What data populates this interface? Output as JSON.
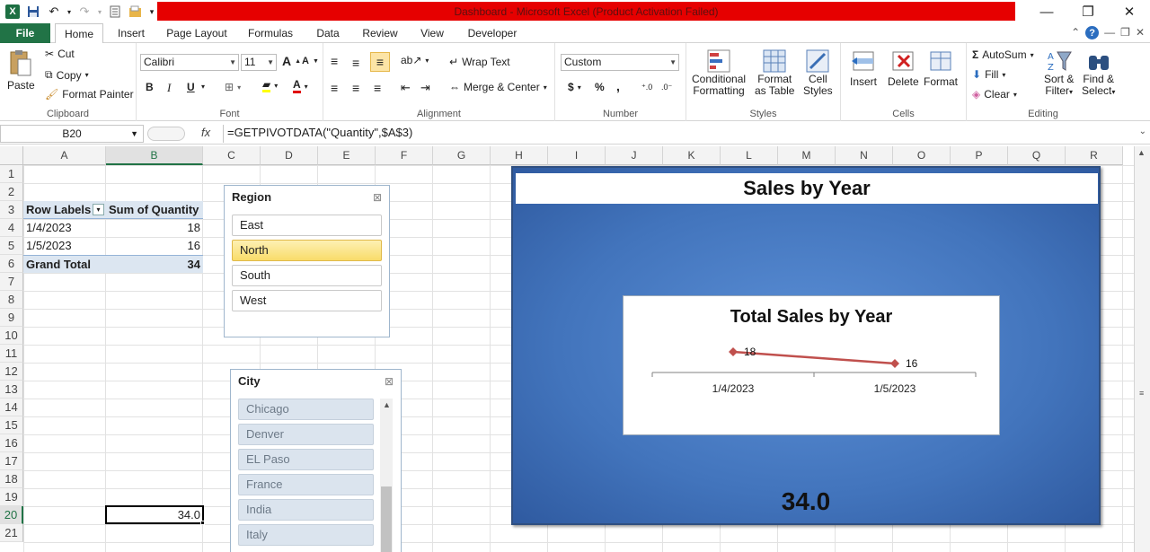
{
  "window": {
    "title": "Dashboard - Microsoft Excel (Product Activation Failed)"
  },
  "tabs": [
    "File",
    "Home",
    "Insert",
    "Page Layout",
    "Formulas",
    "Data",
    "Review",
    "View",
    "Developer"
  ],
  "ribbon": {
    "clipboard": {
      "paste": "Paste",
      "cut": "Cut",
      "copy": "Copy",
      "format_painter": "Format Painter",
      "label": "Clipboard"
    },
    "font": {
      "name": "Calibri",
      "size": "11",
      "label": "Font",
      "bold": "B",
      "italic": "I",
      "underline": "U"
    },
    "alignment": {
      "wrap": "Wrap Text",
      "merge": "Merge & Center",
      "label": "Alignment"
    },
    "number": {
      "format": "Custom",
      "currency": "$",
      "percent": "%",
      "comma": ",",
      "label": "Number"
    },
    "styles": {
      "conditional_1": "Conditional",
      "conditional_2": "Formatting",
      "format_table_1": "Format",
      "format_table_2": "as Table",
      "cell_styles_1": "Cell",
      "cell_styles_2": "Styles",
      "label": "Styles"
    },
    "cells": {
      "insert": "Insert",
      "delete": "Delete",
      "format": "Format",
      "label": "Cells"
    },
    "editing": {
      "autosum": "AutoSum",
      "fill": "Fill",
      "clear": "Clear",
      "sort_1": "Sort &",
      "sort_2": "Filter",
      "find_1": "Find &",
      "find_2": "Select",
      "label": "Editing"
    }
  },
  "formula_bar": {
    "name_box": "B20",
    "fx": "fx",
    "formula": "=GETPIVOTDATA(\"Quantity\",$A$3)"
  },
  "columns": [
    "A",
    "B",
    "C",
    "D",
    "E",
    "F",
    "G",
    "H",
    "I",
    "J",
    "K",
    "L",
    "M",
    "N",
    "O",
    "P",
    "Q",
    "R"
  ],
  "rows": [
    "1",
    "2",
    "3",
    "4",
    "5",
    "6",
    "7",
    "8",
    "9",
    "10",
    "11",
    "12",
    "13",
    "14",
    "15",
    "16",
    "17",
    "18",
    "19",
    "20",
    "21"
  ],
  "pivot": {
    "header_labels": "Row Labels",
    "header_sum": "Sum of Quantity",
    "rows": [
      {
        "label": "1/4/2023",
        "value": "18"
      },
      {
        "label": "1/5/2023",
        "value": "16"
      }
    ],
    "total_label": "Grand Total",
    "total_value": "34"
  },
  "selected_cell_value": "34.0",
  "region_slicer": {
    "title": "Region",
    "items": [
      "East",
      "North",
      "South",
      "West"
    ],
    "selected": "North"
  },
  "city_slicer": {
    "title": "City",
    "items": [
      "Chicago",
      "Denver",
      "EL Paso",
      "France",
      "India",
      "Italy"
    ]
  },
  "dashboard": {
    "title": "Sales by Year",
    "kpi": "34.0"
  },
  "chart_data": {
    "type": "line",
    "title": "Total Sales by Year",
    "categories": [
      "1/4/2023",
      "1/5/2023"
    ],
    "values": [
      18,
      16
    ],
    "data_labels": [
      "18",
      "16"
    ],
    "color": "#c0504d",
    "xlabel": "",
    "ylabel": "",
    "grid": false
  }
}
